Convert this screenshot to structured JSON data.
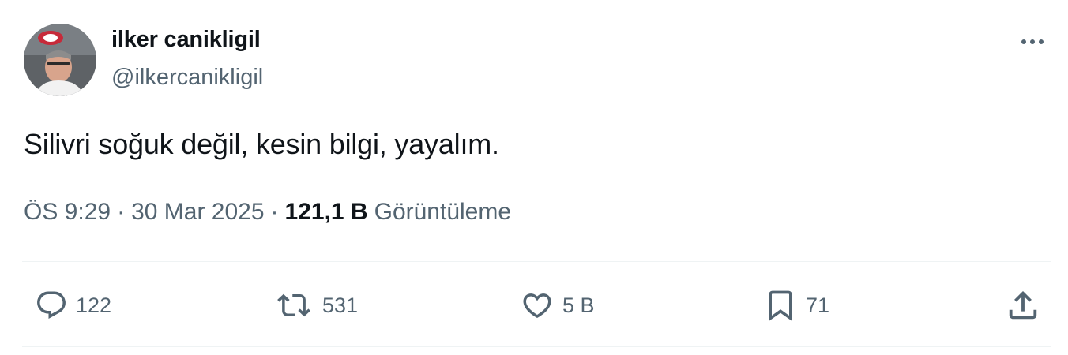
{
  "author": {
    "display_name": "ilker canikligil",
    "handle": "@ilkercanikligil",
    "avatar_icon": "profile-photo"
  },
  "tweet": {
    "text": "Silivri soğuk değil, kesin bilgi, yayalım.",
    "time": "ÖS 9:29",
    "separator": "·",
    "date": "30 Mar 2025",
    "views_count": "121,1 B",
    "views_label": "Görüntüleme"
  },
  "actions": {
    "reply": {
      "icon": "reply-icon",
      "count": "122"
    },
    "retweet": {
      "icon": "retweet-icon",
      "count": "531"
    },
    "like": {
      "icon": "heart-icon",
      "count": "5 B"
    },
    "bookmark": {
      "icon": "bookmark-icon",
      "count": "71"
    },
    "share": {
      "icon": "share-icon"
    }
  },
  "colors": {
    "text_primary": "#0f1419",
    "text_secondary": "#536471",
    "divider": "#eff3f4"
  }
}
